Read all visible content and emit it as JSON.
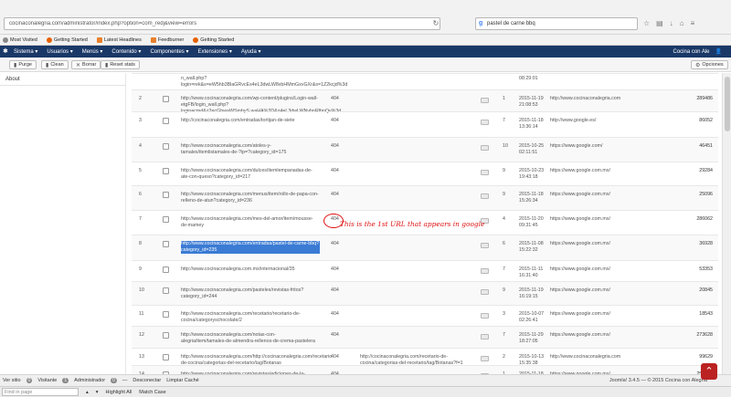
{
  "browser": {
    "url": "cocinaconalegria.com/administrator/index.php?option=com_redj&view=errors",
    "search_value": "pastel de carne bbq",
    "search_engine_icon": "g",
    "bookmarks": [
      "Most Visited",
      "Getting Started",
      "Latest Headlines",
      "Feedburner",
      "Getting Started"
    ]
  },
  "admin": {
    "menus": [
      "Sistema ▾",
      "Usuarios ▾",
      "Menús ▾",
      "Contenido ▾",
      "Componentes ▾",
      "Extensiones ▾",
      "Ayuda ▾"
    ],
    "site_name": "Cocina con Ale"
  },
  "toolbar": {
    "purge": "Purge",
    "clean": "Clean",
    "delete": "Borrar",
    "reset": "Reset stats",
    "options": "Opciones"
  },
  "sidebar": {
    "about": "About"
  },
  "table": {
    "rows": [
      {
        "num": "",
        "url": "n_wall.php?login=rek&s=eW5hb3BlaGRvcEs4eL3dwLW8vbHMmGxvGXr&s=1Z2kcjd%3d",
        "code": "",
        "redir": "",
        "hits": "",
        "date": "08:29:01",
        "ref": "",
        "id": ""
      },
      {
        "num": "2",
        "url": "http://www.cocinaconalegria.com/wp-content/plugins/Login-wall-etgFB/login_wall.php?login=cmd&z2=cGhwaWSmbyS.waHA%3D&z4=L3dwLWNvbnRlbnQv%3d",
        "code": "404",
        "redir": "",
        "hits": "1",
        "date": "2015-11-19 21:08:53",
        "ref": "http://www.cocinaconalegria.com",
        "id": "289486"
      },
      {
        "num": "3",
        "url": "http://cocinaconalegria.com/entradas/tortijan-de-siete",
        "code": "404",
        "redir": "",
        "hits": "7",
        "date": "2015-11-18 13:36:14",
        "ref": "http://www.google.es/",
        "id": "86052"
      },
      {
        "num": "4",
        "url": "http://www.cocinaconalegria.com/atoles-y-tamales/itemlistamales-de-?ip=?category_id=175",
        "code": "404",
        "redir": "",
        "hits": "10",
        "date": "2015-10-25 02:11:51",
        "ref": "https://www.google.com/",
        "id": "46451"
      },
      {
        "num": "5",
        "url": "http://www.cocinaconalegria.com/dulces/itemlempanadas-de-ate-con-queso?category_id=217",
        "code": "404",
        "redir": "",
        "hits": "9",
        "date": "2015-10-23 19:43:18",
        "ref": "https://www.google.com.mx/",
        "id": "29284"
      },
      {
        "num": "6",
        "url": "http://www.cocinaconalegria.com/menus/item/rollo-de-papa-con-relleno-de-atun?category_id=236",
        "code": "404",
        "redir": "",
        "hits": "9",
        "date": "2015-11-18 15:26:34",
        "ref": "https://www.google.com.mx/",
        "id": "25096"
      },
      {
        "num": "7",
        "url": "http://www.cocinaconalegria.com/mes-del-amor/item/mousse-de-mamey",
        "code": "404",
        "redir": "",
        "hits": "4",
        "date": "2015-11-20 09:31:45",
        "ref": "https://www.google.com.mx/",
        "id": "286062"
      },
      {
        "num": "8",
        "url": "http://www.cocinaconalegria.com/entradas/pastel-de-carne-bbq?category_id=235",
        "code": "404",
        "redir": "",
        "hits": "6",
        "date": "2015-11-08 15:22:32",
        "ref": "https://www.google.com.mx/",
        "id": "36928"
      },
      {
        "num": "9",
        "url": "http://www.cocinaconalegria.com.mx/internacional/35",
        "code": "404",
        "redir": "",
        "hits": "7",
        "date": "2015-11-11 16:31:40",
        "ref": "https://www.google.com.mx/",
        "id": "53353"
      },
      {
        "num": "10",
        "url": "http://www.cocinaconalegria.com/pasteles/revistas-fritos?category_id=244",
        "code": "404",
        "redir": "",
        "hits": "9",
        "date": "2015-11-19 16:19:15",
        "ref": "https://www.google.com.mx/",
        "id": "20845"
      },
      {
        "num": "11",
        "url": "http://www.cocinaconalegria.com/recetario/recetario-de-cocina/categoryschocolate/2",
        "code": "404",
        "redir": "",
        "hits": "3",
        "date": "2015-10-07 02:26:41",
        "ref": "https://www.google.com.mx/",
        "id": "18543"
      },
      {
        "num": "12",
        "url": "http://www.cocinaconalegria.com/notas-con-alegria/item/tamales-de-almendra-rellenos-de-crema-pastelera",
        "code": "404",
        "redir": "",
        "hits": "7",
        "date": "2015-11-29 18:27:05",
        "ref": "https://www.google.com.mx/",
        "id": "273628"
      },
      {
        "num": "13",
        "url": "http://www.cocinaconalegria.com/http://cocinaconalegria.com/recetario-de-cocina/categorias-del-recetario/tag/Botanas",
        "code": "404",
        "redir": "http://cocinaconalegria.com/recetario-de-cocina/categorias-del-recetario/tag/Botanas?f=1",
        "hits": "2",
        "date": "2015-10-13 15:35:38",
        "ref": "http://www.cocinaconalegria.com",
        "id": "99629"
      },
      {
        "num": "14",
        "url": "http://www.cocinaconalegria.com/revistas/ediciones-de-la-revista/category/revistas-cocina-con-alegria",
        "code": "404",
        "redir": "",
        "hits": "1",
        "date": "2015-11-18 12:07:19",
        "ref": "https://www.google.com.mx/",
        "id": "251082"
      },
      {
        "num": "15",
        "url": "http://www.cocinaconalegria.com/entradas/37",
        "code": "404",
        "redir": "",
        "hits": "7",
        "date": "2015-11-06",
        "ref": "https://www.google.co.ve/",
        "id": ""
      }
    ],
    "annotation": "This is the 1st URL  that appears in google"
  },
  "status": {
    "ver_sitio": "Ver sitio",
    "visitante_count": "0",
    "visitante": "Visitante",
    "admin_count": "1",
    "admin": "Administrador",
    "msg_count": "0",
    "msg": "—",
    "logout": "Desconectar",
    "cache": "Limpiar Caché",
    "footer": "Joomla! 3.4.5 — © 2015 Cocina con Alegría"
  },
  "findbar": {
    "placeholder": "Find in page",
    "highlight": "Highlight All",
    "match_case": "Match Case"
  }
}
